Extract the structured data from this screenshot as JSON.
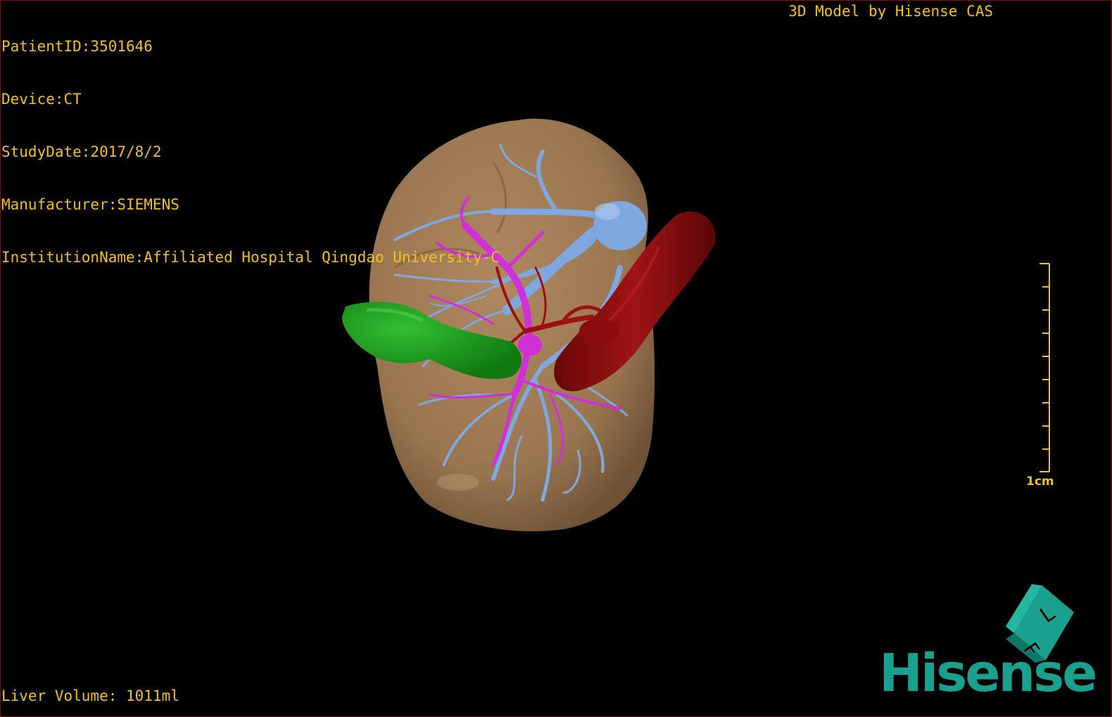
{
  "overlay": {
    "patient_id": "PatientID:3501646",
    "device": "Device:CT",
    "study_date": "StudyDate:2017/8/2",
    "manufacturer": "Manufacturer:SIEMENS",
    "institution": "InstitutionName:Affiliated Hospital Qingdao University-C",
    "credit": "3D Model by Hisense CAS",
    "liver_volume": "Liver Volume: 1011ml",
    "scale_label": "1cm"
  },
  "logo": {
    "brand": "Hisense",
    "cube_letters": [
      "F",
      "L"
    ]
  },
  "colors": {
    "text": "#f2c020",
    "liver": "#9a7650",
    "portal_vein": "#7fa8e0",
    "hepatic_artery": "#9b1010",
    "bile_duct": "#d030d8",
    "gallbladder": "#1e9a1e",
    "brand": "#1aa08e"
  }
}
